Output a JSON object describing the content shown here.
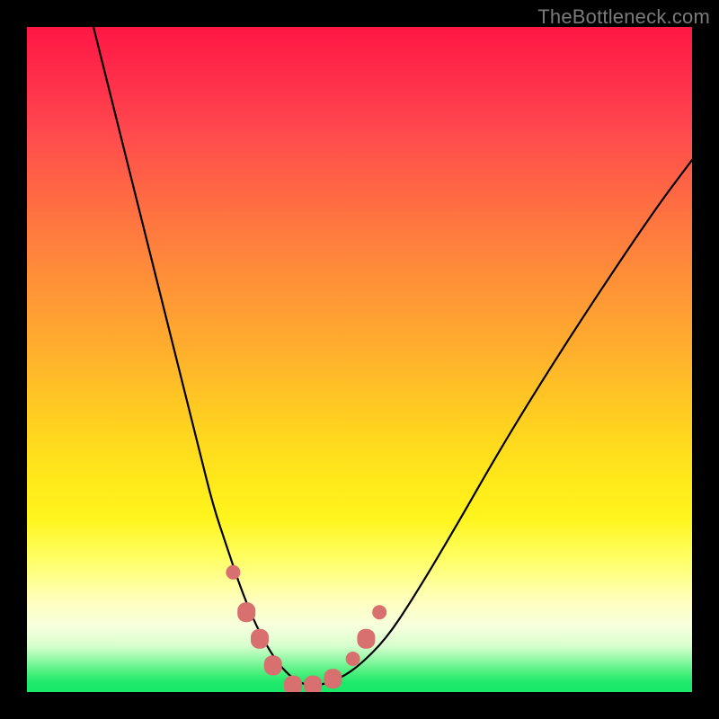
{
  "watermark": "TheBottleneck.com",
  "chart_data": {
    "type": "line",
    "title": "",
    "xlabel": "",
    "ylabel": "",
    "xlim": [
      0,
      100
    ],
    "ylim": [
      0,
      100
    ],
    "grid": false,
    "series": [
      {
        "name": "bottleneck-curve",
        "x": [
          10,
          14,
          18,
          22,
          26,
          28,
          30,
          32,
          34,
          36,
          38,
          40,
          42,
          44,
          47,
          50,
          54,
          58,
          64,
          72,
          82,
          94,
          100
        ],
        "y": [
          100,
          84,
          68,
          52,
          36,
          28,
          22,
          16,
          11,
          7,
          4,
          2,
          1,
          1,
          2,
          4,
          8,
          14,
          24,
          38,
          54,
          72,
          80
        ]
      }
    ],
    "markers": {
      "name": "highlight-points",
      "color": "#d87070",
      "points": [
        {
          "x": 31,
          "y": 18,
          "kind": "dot"
        },
        {
          "x": 33,
          "y": 12,
          "kind": "blob"
        },
        {
          "x": 35,
          "y": 8,
          "kind": "blob"
        },
        {
          "x": 37,
          "y": 4,
          "kind": "blob"
        },
        {
          "x": 40,
          "y": 1,
          "kind": "blob"
        },
        {
          "x": 43,
          "y": 1,
          "kind": "blob"
        },
        {
          "x": 46,
          "y": 2,
          "kind": "blob"
        },
        {
          "x": 49,
          "y": 5,
          "kind": "dot"
        },
        {
          "x": 51,
          "y": 8,
          "kind": "blob"
        },
        {
          "x": 53,
          "y": 12,
          "kind": "dot"
        }
      ]
    }
  }
}
